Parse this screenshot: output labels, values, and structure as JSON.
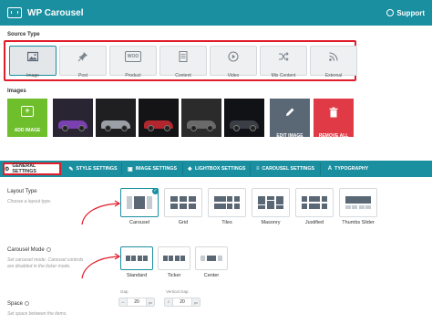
{
  "header": {
    "title": "WP Carousel",
    "support_label": "Support"
  },
  "source_type": {
    "label": "Source Type",
    "items": [
      {
        "label": "Image",
        "icon": "image-icon",
        "active": true
      },
      {
        "label": "Post",
        "icon": "pin-icon"
      },
      {
        "label": "Product",
        "icon": "woo-icon",
        "icon_text": "WOO"
      },
      {
        "label": "Content",
        "icon": "document-icon"
      },
      {
        "label": "Video",
        "icon": "play-icon"
      },
      {
        "label": "Mix Content",
        "icon": "shuffle-icon"
      },
      {
        "label": "External",
        "icon": "rss-icon"
      }
    ]
  },
  "images": {
    "label": "Images",
    "add_label": "ADD IMAGE",
    "edit_label": "EDIT IMAGE",
    "remove_label": "REMOVE ALL",
    "thumbnails": [
      {
        "name": "purple-car",
        "color": "#7a3fb0"
      },
      {
        "name": "silver-car",
        "color": "#9aa0a6"
      },
      {
        "name": "red-car",
        "color": "#b3262e"
      },
      {
        "name": "hot-rod",
        "color": "#6a6a6a"
      },
      {
        "name": "black-car",
        "color": "#3a3f46"
      }
    ]
  },
  "tabs": [
    {
      "label": "GENERAL SETTINGS",
      "icon": "gear-icon",
      "active": true
    },
    {
      "label": "STYLE SETTINGS",
      "icon": "brush-icon"
    },
    {
      "label": "IMAGE SETTINGS",
      "icon": "image-icon"
    },
    {
      "label": "LIGHTBOX SETTINGS",
      "icon": "lightbox-icon"
    },
    {
      "label": "CAROUSEL SETTINGS",
      "icon": "sliders-icon"
    },
    {
      "label": "TYPOGRAPHY",
      "icon": "text-icon"
    }
  ],
  "layout_type": {
    "label": "Layout Type",
    "hint": "Choose a layout type.",
    "options": [
      {
        "label": "Carousel",
        "selected": true
      },
      {
        "label": "Grid"
      },
      {
        "label": "Tiles"
      },
      {
        "label": "Masonry"
      },
      {
        "label": "Justified"
      },
      {
        "label": "Thumbs Slider"
      }
    ]
  },
  "carousel_mode": {
    "label": "Carousel Mode",
    "hint_line1": "Set carousel mode. Carousel controls",
    "hint_line2": "are disabled in the ticker mode.",
    "options": [
      {
        "label": "Standard",
        "selected": true
      },
      {
        "label": "Ticker"
      },
      {
        "label": "Center"
      }
    ]
  },
  "space": {
    "label": "Space",
    "hint": "Set space between the items.",
    "gap_label": "Gap",
    "vertical_gap_label": "Vertical Gap",
    "gap_value": "20",
    "vertical_gap_value": "20",
    "unit": "px"
  },
  "colors": {
    "accent": "#1a8fa0",
    "highlight": "#e11d2a",
    "add": "#6fbe2c",
    "remove": "#e03a47",
    "edit": "#5a6775"
  }
}
